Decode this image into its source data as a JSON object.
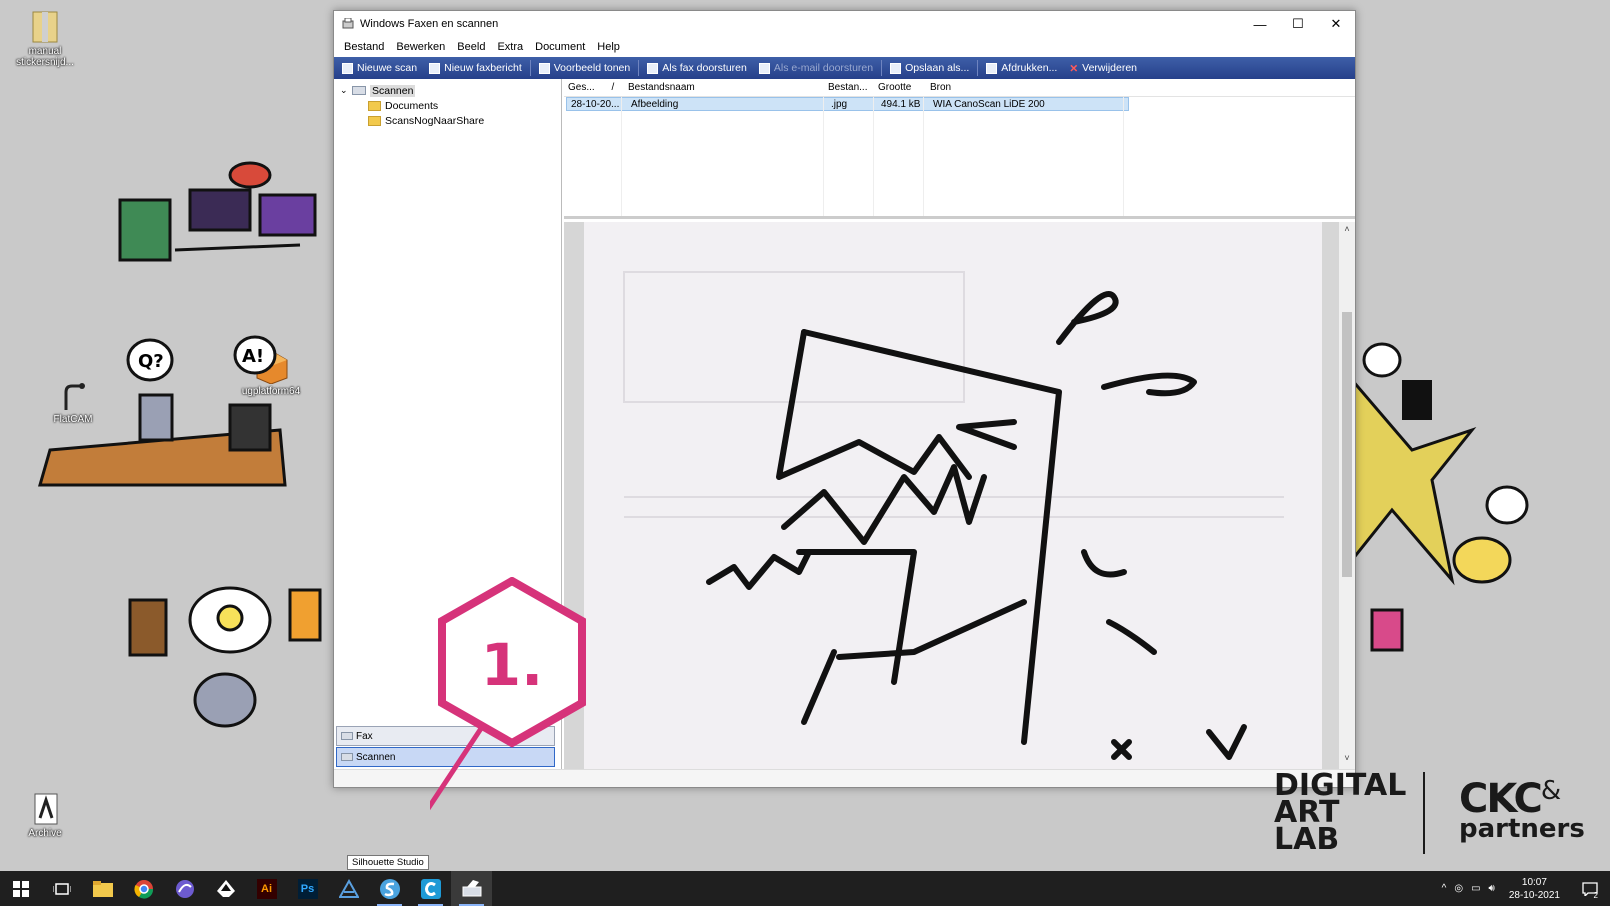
{
  "desktop": {
    "icons": [
      {
        "label": "manual stickersnijd..."
      },
      {
        "label": "FlatCAM"
      },
      {
        "label": "ugplatform64"
      },
      {
        "label": "Archive"
      }
    ]
  },
  "window": {
    "title": "Windows Faxen en scannen",
    "controls": {
      "minimize": "—",
      "maximize": "☐",
      "close": "✕"
    },
    "menu": [
      "Bestand",
      "Bewerken",
      "Beeld",
      "Extra",
      "Document",
      "Help"
    ],
    "toolbar": [
      {
        "label": "Nieuwe scan",
        "enabled": true
      },
      {
        "label": "Nieuw faxbericht",
        "enabled": true
      },
      {
        "label": "Voorbeeld tonen",
        "enabled": true
      },
      {
        "label": "Als fax doorsturen",
        "enabled": true
      },
      {
        "label": "Als e-mail doorsturen",
        "enabled": false
      },
      {
        "label": "Opslaan als...",
        "enabled": true
      },
      {
        "label": "Afdrukken...",
        "enabled": true
      },
      {
        "label": "Verwijderen",
        "enabled": true
      }
    ],
    "tree": {
      "root": "Scannen",
      "children": [
        "Documents",
        "ScansNogNaarShare"
      ]
    },
    "nav": [
      "Fax",
      "Scannen"
    ],
    "list": {
      "columns": [
        "Ges...",
        "Bestandsnaam",
        "Bestan...",
        "Grootte",
        "Bron"
      ],
      "sort_indicator": "/",
      "rows": [
        {
          "date": "28-10-20...",
          "name": "Afbeelding",
          "type": ".jpg",
          "size": "494.1 kB",
          "source": "WIA CanoScan LiDE 200"
        }
      ]
    },
    "preview": {
      "scrollbar_up": "˄",
      "scrollbar_down": "˅"
    }
  },
  "annotation": {
    "step": "1.",
    "color": "#d6337a"
  },
  "tooltip": "Silhouette Studio",
  "logos": {
    "dal": [
      "DIGITAL",
      "ART",
      "LAB"
    ],
    "ckc": "CKC",
    "amp": "&",
    "partners": "partners"
  },
  "taskbar": {
    "apps": [
      "start-icon",
      "task-view-icon",
      "file-explorer-icon",
      "chrome-icon",
      "app-icon",
      "inkscape-icon",
      "illustrator-icon",
      "photoshop-icon",
      "app-icon",
      "silhouette-studio-icon",
      "app-c-icon",
      "fax-scan-icon"
    ],
    "illustrator_label": "Ai",
    "photoshop_label": "Ps",
    "time": "10:07",
    "date": "28-10-2021",
    "notifications": "2"
  }
}
